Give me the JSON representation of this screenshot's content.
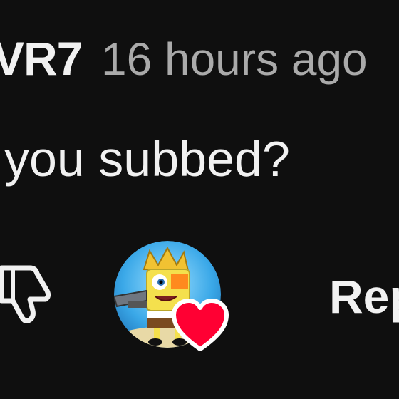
{
  "comment": {
    "author": "VR7",
    "timestamp": "16 hours ago",
    "text": "you subbed?"
  },
  "actions": {
    "dislike_icon": "thumbs-down-icon",
    "creator_heart_icon": "heart-icon",
    "reply_label": "Rep"
  },
  "colors": {
    "background": "#0f0f0f",
    "primary_text": "#f1f1f1",
    "secondary_text": "#aaaaaa",
    "heart": "#ff0033"
  }
}
